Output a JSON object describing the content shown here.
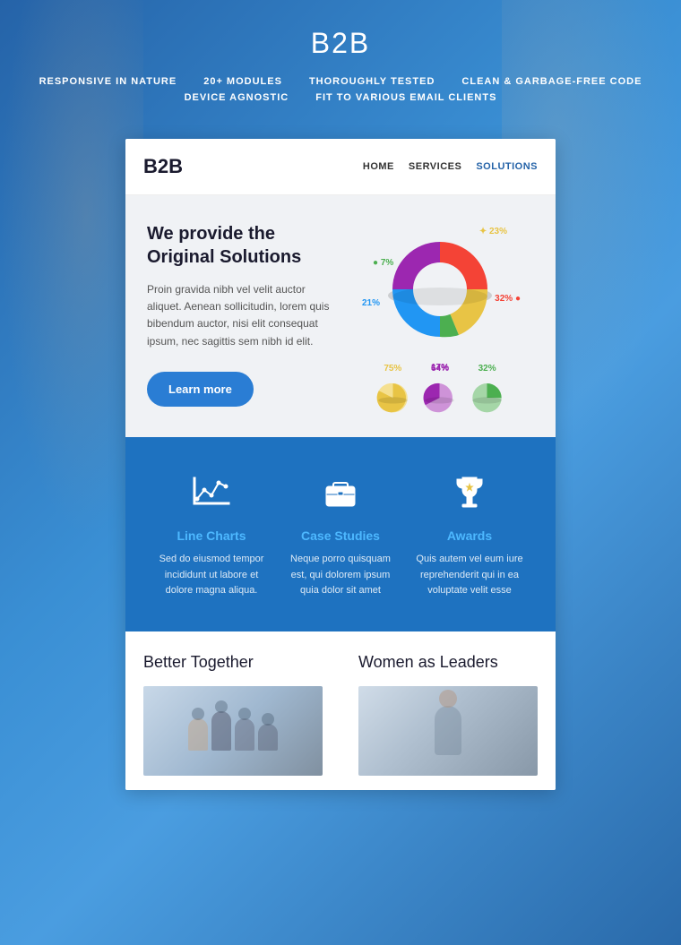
{
  "header": {
    "title": "B2B",
    "features": [
      "RESPONSIVE IN NATURE",
      "20+ MODULES",
      "THOROUGHLY TESTED",
      "CLEAN & GARBAGE-FREE CODE",
      "DEVICE AGNOSTIC",
      "FIT TO VARIOUS EMAIL CLIENTS"
    ]
  },
  "card": {
    "logo": "B2B",
    "nav": [
      {
        "label": "HOME",
        "active": false
      },
      {
        "label": "SERVICES",
        "active": false
      },
      {
        "label": "SOLUTIONS",
        "active": true
      }
    ],
    "hero": {
      "title": "We provide the Original Solutions",
      "body": "Proin gravida nibh vel velit auctor aliquet. Aenean sollicitudin, lorem quis bibendum auctor, nisi elit consequat ipsum, nec sagittis sem nibh id elit.",
      "cta": "Learn more"
    },
    "donut": {
      "segments": [
        {
          "percent": 32,
          "color": "#f44336"
        },
        {
          "percent": 23,
          "color": "#e8c445"
        },
        {
          "percent": 7,
          "color": "#4caf50"
        },
        {
          "percent": 21,
          "color": "#2196f3"
        },
        {
          "percent": 17,
          "color": "#9c27b0"
        }
      ],
      "labels": [
        "32%",
        "23%",
        "7%",
        "21%",
        "17%"
      ]
    },
    "mini_charts": [
      {
        "label": "75%",
        "color": "#e8c445"
      },
      {
        "label": "64%",
        "color": "#9c27b0"
      },
      {
        "label": "32%",
        "color": "#4caf50"
      }
    ],
    "features": [
      {
        "icon": "line-chart-icon",
        "title": "Line Charts",
        "desc": "Sed do eiusmod tempor incididunt ut labore et dolore magna aliqua."
      },
      {
        "icon": "briefcase-icon",
        "title": "Case Studies",
        "desc": "Neque porro quisquam est, qui dolorem ipsum quia dolor sit amet"
      },
      {
        "icon": "trophy-icon",
        "title": "Awards",
        "desc": "Quis autem vel eum iure reprehenderit qui in ea voluptate velit esse"
      }
    ],
    "bottom": [
      {
        "title": "Better Together"
      },
      {
        "title": "Women as Leaders"
      }
    ]
  }
}
